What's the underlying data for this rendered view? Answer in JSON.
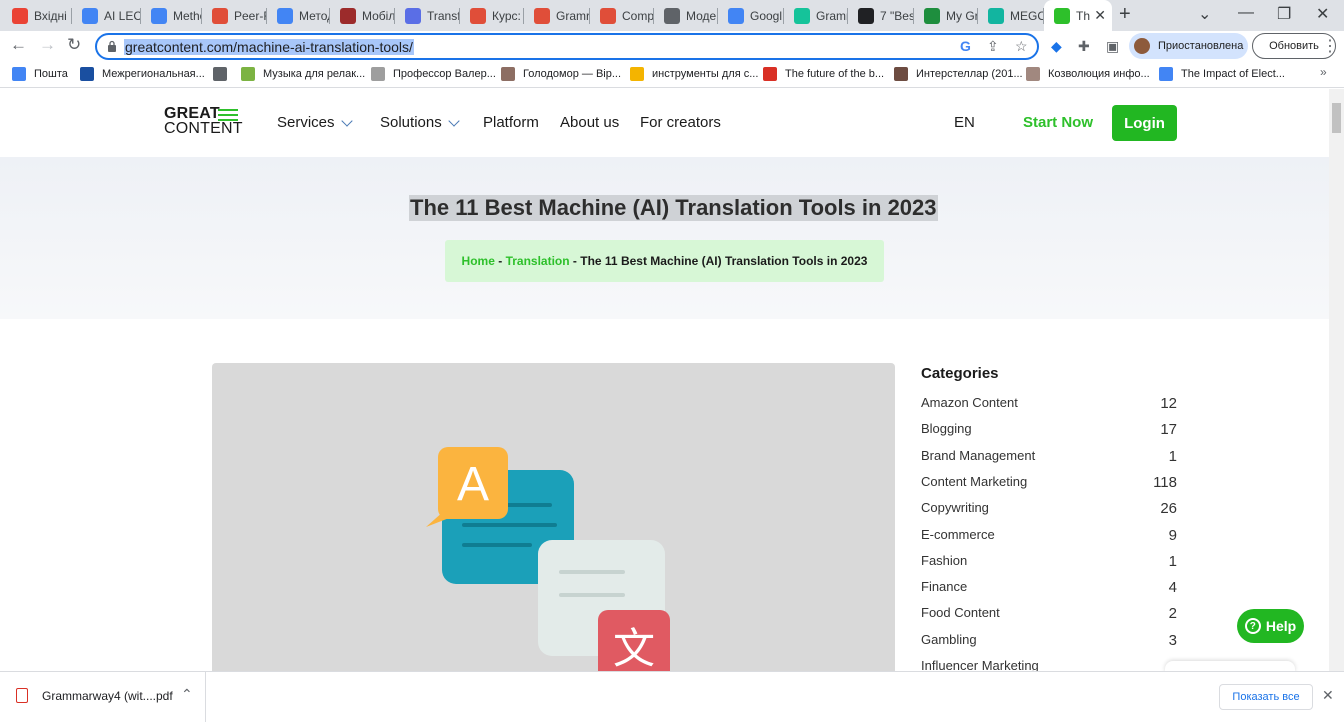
{
  "browser": {
    "tabs": [
      {
        "label": "Вхідні",
        "icon": "gmail-icon",
        "color": "#ea4335"
      },
      {
        "label": "AI LEC",
        "icon": "docs-icon",
        "color": "#4285f4"
      },
      {
        "label": "Metho",
        "icon": "docs-icon",
        "color": "#4285f4"
      },
      {
        "label": "Peer-R",
        "icon": "uzh-icon",
        "color": "#e04e39"
      },
      {
        "label": "Метод",
        "icon": "docs-icon",
        "color": "#4285f4"
      },
      {
        "label": "Мобіл",
        "icon": "book-icon",
        "color": "#9c2b2b"
      },
      {
        "label": "Transf",
        "icon": "chat-icon",
        "color": "#5a6ee6"
      },
      {
        "label": "Курс:",
        "icon": "uzh-icon",
        "color": "#e04e39"
      },
      {
        "label": "Gramr",
        "icon": "uzh-icon",
        "color": "#e04e39"
      },
      {
        "label": "Comp",
        "icon": "uzh-icon",
        "color": "#e04e39"
      },
      {
        "label": "Моде",
        "icon": "openai-icon",
        "color": "#5f6368"
      },
      {
        "label": "Googl",
        "icon": "translate-icon",
        "color": "#4285f4"
      },
      {
        "label": "Gramr",
        "icon": "grammarly-icon",
        "color": "#15c39a"
      },
      {
        "label": "7 \"Bes",
        "icon": "robot-icon",
        "color": "#202124"
      },
      {
        "label": "My Gr",
        "icon": "gf-icon",
        "color": "#1e8e3e"
      },
      {
        "label": "MEGO",
        "icon": "folder-icon",
        "color": "#12b5a0"
      },
      {
        "label": "Th",
        "icon": "greatcontent-icon",
        "color": "#2ec02b"
      }
    ],
    "url": "greatcontent.com/machine-ai-translation-tools/",
    "profile_label": "Приостановлена",
    "update_label": "Обновить",
    "bookmarks": [
      {
        "label": "Пошта",
        "color": "#4285f4"
      },
      {
        "label": "Межрегиональная...",
        "color": "#1a4fa0"
      },
      {
        "label": "",
        "color": "#5f6368"
      },
      {
        "label": "Музыка для релак...",
        "color": "#7cb342"
      },
      {
        "label": "Професcор Валер...",
        "color": "#9e9e9e"
      },
      {
        "label": "Голодомор — Віp...",
        "color": "#8d6e63"
      },
      {
        "label": "инструменты для с...",
        "color": "#f4b400"
      },
      {
        "label": "The future of the b...",
        "color": "#d93025"
      },
      {
        "label": "Интерстеллар (201...",
        "color": "#6d4c41"
      },
      {
        "label": "Козволюция инфо...",
        "color": "#a1887f"
      },
      {
        "label": "The Impact of Elect...",
        "color": "#4285f4"
      }
    ]
  },
  "site": {
    "logo_line1": "GREAT",
    "logo_line2": "CONTENT",
    "nav": {
      "services": "Services",
      "solutions": "Solutions",
      "platform": "Platform",
      "about": "About us",
      "creators": "For creators"
    },
    "lang": "EN",
    "start_now": "Start Now",
    "login": "Login",
    "page_title": "The 11 Best Machine (AI) Translation Tools in 2023",
    "breadcrumb": {
      "home": "Home",
      "sep1": " - ",
      "translation": "Translation",
      "sep2": " - ",
      "current": "The 11 Best Machine (AI) Translation Tools in 2023"
    },
    "illustration": {
      "letter_a": "A",
      "letter_zh": "文"
    },
    "categories_title": "Categories",
    "categories": [
      {
        "name": "Amazon Content",
        "count": "12"
      },
      {
        "name": "Blogging",
        "count": "17"
      },
      {
        "name": "Brand Management",
        "count": "1"
      },
      {
        "name": "Content Marketing",
        "count": "118"
      },
      {
        "name": "Copywriting",
        "count": "26"
      },
      {
        "name": "E-commerce",
        "count": "9"
      },
      {
        "name": "Fashion",
        "count": "1"
      },
      {
        "name": "Finance",
        "count": "4"
      },
      {
        "name": "Food Content",
        "count": "2"
      },
      {
        "name": "Gambling",
        "count": "3"
      },
      {
        "name": "Influencer Marketing",
        "count": ""
      }
    ],
    "help": "Help"
  },
  "downloads": {
    "file": "Grammarway4 (wit....pdf",
    "show_all": "Показать все"
  }
}
